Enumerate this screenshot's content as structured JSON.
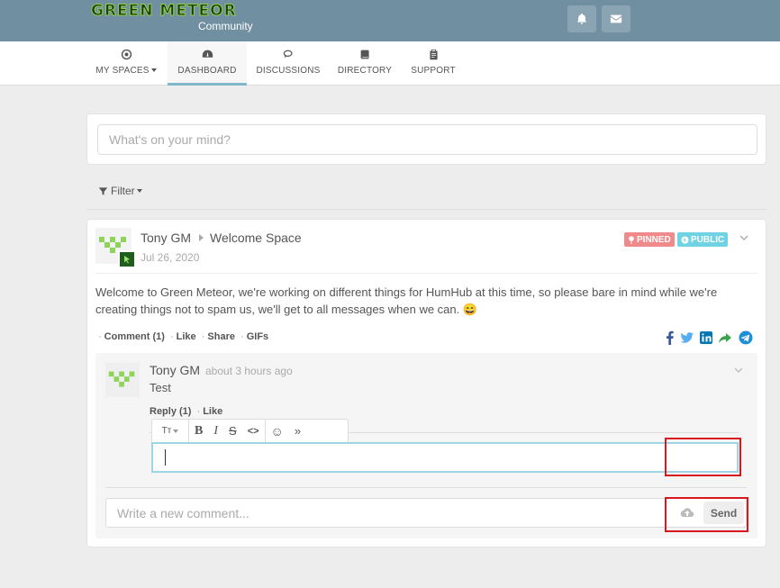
{
  "header": {
    "logo_text": "GREEN METEOR",
    "logo_sub": "Community",
    "notification_icon": "bell-icon",
    "messages_icon": "envelope-icon"
  },
  "nav": {
    "items": [
      {
        "label": "MY SPACES",
        "icon": "dot-circle-icon"
      },
      {
        "label": "DASHBOARD",
        "icon": "dashboard-icon",
        "active": true
      },
      {
        "label": "DISCUSSIONS",
        "icon": "comments-icon"
      },
      {
        "label": "DIRECTORY",
        "icon": "book-icon"
      },
      {
        "label": "SUPPORT",
        "icon": "clipboard-icon"
      }
    ]
  },
  "composer": {
    "placeholder": "What's on your mind?"
  },
  "filter": {
    "label": "Filter"
  },
  "post": {
    "author": "Tony GM",
    "space": "Welcome Space",
    "date": "Jul 26, 2020",
    "badges": {
      "pinned": "PINNED",
      "public": "PUBLIC"
    },
    "text": "Welcome to Green Meteor, we're working on different things for HumHub at this time, so please bare in mind while we're creating things not to spam us, we'll get to all messages when we can. 😄",
    "actions": {
      "comment": "Comment (1)",
      "like": "Like",
      "share": "Share",
      "gifs": "GIFs"
    },
    "colors": {
      "pinned": "#f08a8a",
      "public": "#6fd3e3",
      "accent": "#7fb8c9"
    }
  },
  "comment": {
    "author": "Tony GM",
    "time": "about 3 hours ago",
    "text": "Test",
    "reply": "Reply (1)",
    "like": "Like"
  },
  "editor": {
    "tools": [
      "Tт",
      "B",
      "I",
      "S",
      "<>",
      "☺",
      "»"
    ]
  },
  "new_comment": {
    "placeholder": "Write a new comment...",
    "send": "Send"
  }
}
